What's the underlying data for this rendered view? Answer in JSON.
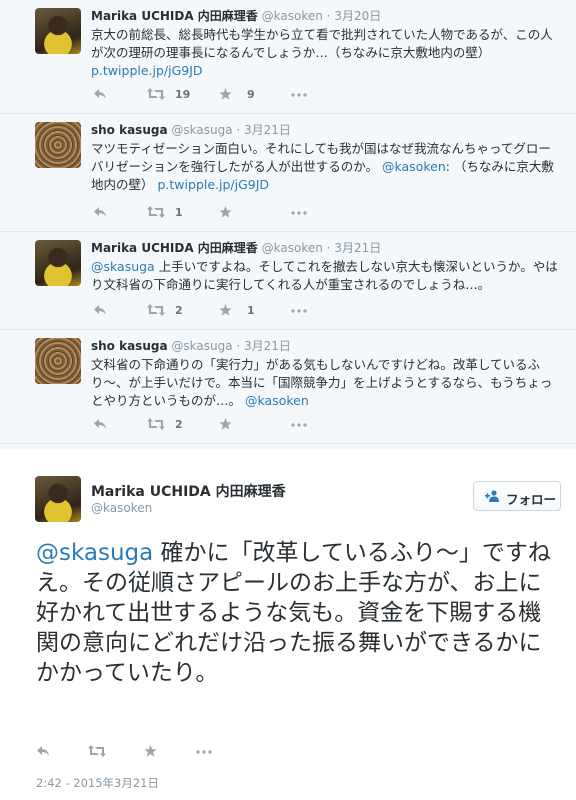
{
  "tweets": [
    {
      "fullname": "Marika UCHIDA 内田麻理香",
      "handle": "@kasoken",
      "time": "3月20日",
      "text": "京大の前総長、総長時代も学生から立て看で批判されていた人物であるが、この人が次の理研の理事長になるんでしょうか…（ちなみに京大敷地内の壁）",
      "link": "p.twipple.jp/jG9JD",
      "retweets": "19",
      "favorites": "9"
    },
    {
      "fullname": "sho kasuga",
      "handle": "@skasuga",
      "time": "3月21日",
      "text": "マツモティゼーション面白い。それにしても我が国はなぜ我流なんちゃってグローバリゼーションを強行したがる人が出世するのか。",
      "mention": "@kasoken",
      "text2": ": （ちなみに京大敷地内の壁）",
      "link": "p.twipple.jp/jG9JD",
      "retweets": "1"
    },
    {
      "fullname": "Marika UCHIDA 内田麻理香",
      "handle": "@kasoken",
      "time": "3月21日",
      "mention": "@skasuga",
      "text": " 上手いですよね。そしてこれを撤去しない京大も懐深いというか。やはり文科省の下命通りに実行してくれる人が重宝されるのでしょうね…。",
      "retweets": "2",
      "favorites": "1"
    },
    {
      "fullname": "sho kasuga",
      "handle": "@skasuga",
      "time": "3月21日",
      "text": "文科省の下命通りの「実行力」がある気もしないんですけどね。改革しているふり〜、が上手いだけで。本当に「国際競争力」を上げようとするなら、もうちょっとやり方というものが…。",
      "mention": "@kasoken",
      "retweets": "2"
    }
  ],
  "main": {
    "fullname": "Marika UCHIDA 内田麻理香",
    "handle": "@kasoken",
    "follow_label": "フォロー",
    "mention": "@skasuga",
    "text": " 確かに「改革しているふり〜」ですねえ。その従順さアピールのお上手な方が、お上に好かれて出世するような気も。資金を下賜する機関の意向にどれだけ沿った振る舞いができるかにかかっていたり。",
    "date": "2:42 - 2015年3月21日"
  },
  "colors": {
    "link": "#2b7bb9",
    "muted": "#8899a6",
    "icon": "#9aa6b0"
  }
}
